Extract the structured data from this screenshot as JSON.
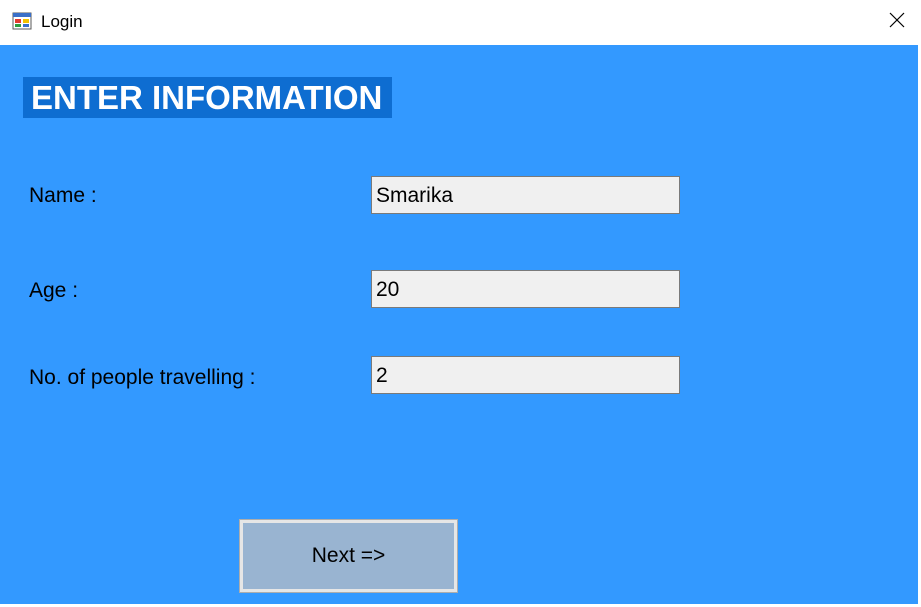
{
  "window": {
    "title": "Login",
    "app_icon": "windows-form-icon",
    "close_icon": "close-icon"
  },
  "form": {
    "heading": "ENTER INFORMATION",
    "name_label": "Name :",
    "name_value": "Smarika",
    "age_label": "Age :",
    "age_value": "20",
    "people_label": "No. of people travelling :",
    "people_value": "2",
    "next_label": "Next =>"
  },
  "colors": {
    "background": "#3399ff",
    "heading_bg": "#0e6dd1",
    "button_bg": "#99b4d1",
    "field_bg": "#f0f0f0"
  }
}
